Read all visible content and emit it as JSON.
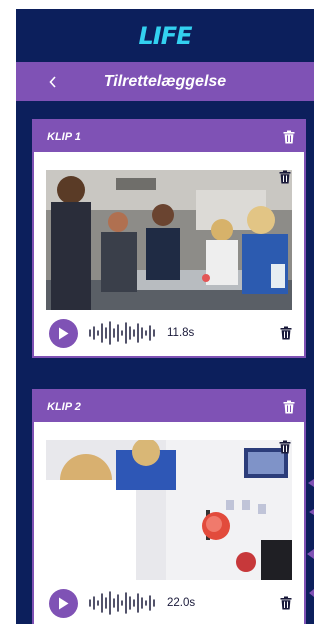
{
  "app": {
    "logo": "LIFE"
  },
  "header": {
    "title": "Tilrettelæggelse",
    "back_icon": "chevron-left-icon"
  },
  "clips": [
    {
      "title": "KLIP 1",
      "duration": "11.8s",
      "image": "students-experiment-photo"
    },
    {
      "title": "KLIP 2",
      "duration": "22.0s",
      "image": "pipetting-photo"
    }
  ],
  "colors": {
    "background": "#0c1f5c",
    "accent": "#7f52b5",
    "logo": "#33d1f0"
  }
}
